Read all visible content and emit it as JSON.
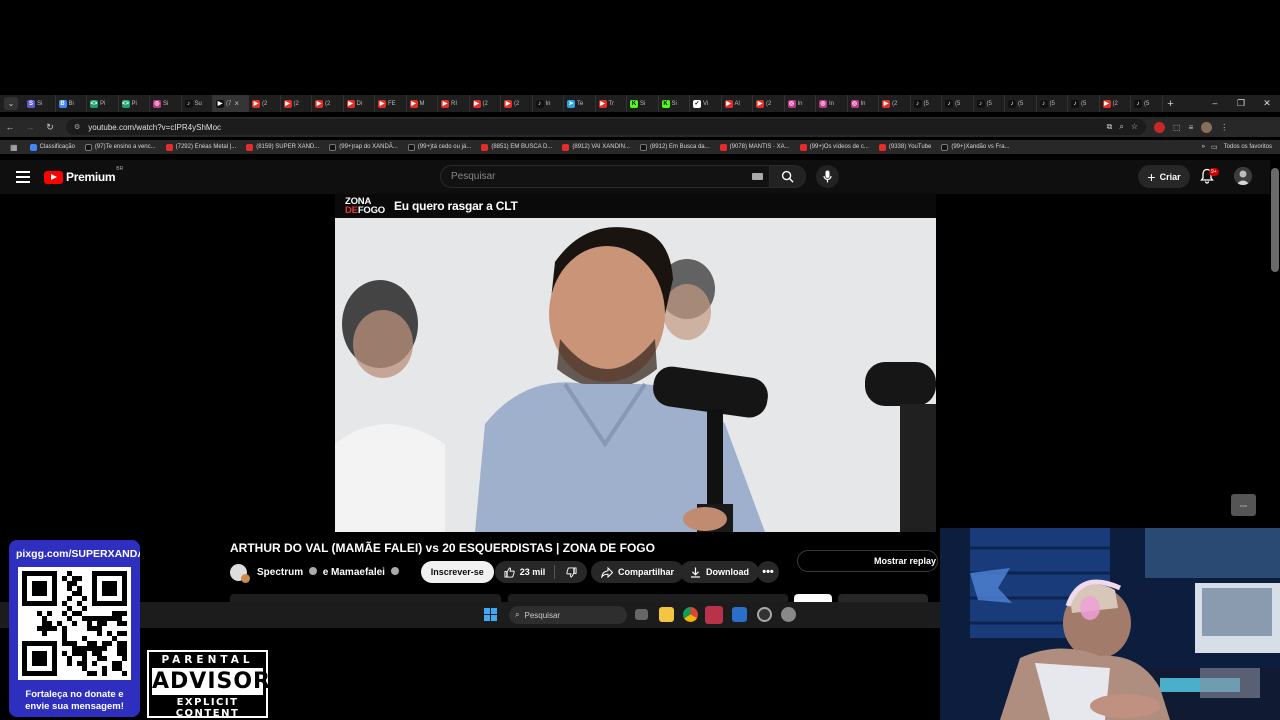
{
  "browser": {
    "tabs": [
      {
        "label": "Si",
        "color": "#5b5bd6",
        "glyph": "S"
      },
      {
        "label": "Bi",
        "color": "#4285f4",
        "glyph": "B"
      },
      {
        "label": "Pi",
        "color": "#22a06b",
        "glyph": "<>"
      },
      {
        "label": "Pi",
        "color": "#22a06b",
        "glyph": "<>"
      },
      {
        "label": "Si",
        "color": "#c13584",
        "glyph": "◎"
      },
      {
        "label": "Su",
        "color": "#111111",
        "glyph": "♪"
      },
      {
        "label": "(7",
        "color": "#111111",
        "glyph": "▶",
        "active": true
      },
      {
        "label": "(2",
        "color": "#e52d27",
        "glyph": "▶"
      },
      {
        "label": "(2",
        "color": "#e52d27",
        "glyph": "▶"
      },
      {
        "label": "(2",
        "color": "#e52d27",
        "glyph": "▶"
      },
      {
        "label": "Di",
        "color": "#e52d27",
        "glyph": "▶"
      },
      {
        "label": "FE",
        "color": "#e52d27",
        "glyph": "▶"
      },
      {
        "label": "M",
        "color": "#e52d27",
        "glyph": "▶"
      },
      {
        "label": "RI",
        "color": "#e52d27",
        "glyph": "▶"
      },
      {
        "label": "(2",
        "color": "#e52d27",
        "glyph": "▶"
      },
      {
        "label": "(2",
        "color": "#e52d27",
        "glyph": "▶"
      },
      {
        "label": "In",
        "color": "#111111",
        "glyph": "♪"
      },
      {
        "label": "Te",
        "color": "#2aa3e0",
        "glyph": "➤"
      },
      {
        "label": "Tr",
        "color": "#e52d27",
        "glyph": "▶"
      },
      {
        "label": "Si",
        "color": "#53fc18",
        "glyph": "K"
      },
      {
        "label": "Si",
        "color": "#53fc18",
        "glyph": "K"
      },
      {
        "label": "Vi",
        "color": "#ffffff",
        "glyph": "✓"
      },
      {
        "label": "Al",
        "color": "#e52d27",
        "glyph": "▶"
      },
      {
        "label": "(2",
        "color": "#e52d27",
        "glyph": "▶"
      },
      {
        "label": "In",
        "color": "#c13584",
        "glyph": "◎"
      },
      {
        "label": "In",
        "color": "#c13584",
        "glyph": "◎"
      },
      {
        "label": "In",
        "color": "#c13584",
        "glyph": "◎"
      },
      {
        "label": "(2",
        "color": "#e52d27",
        "glyph": "▶"
      },
      {
        "label": "(5",
        "color": "#111111",
        "glyph": "♪"
      },
      {
        "label": "(5",
        "color": "#111111",
        "glyph": "♪"
      },
      {
        "label": "(5",
        "color": "#111111",
        "glyph": "♪"
      },
      {
        "label": "(5",
        "color": "#111111",
        "glyph": "♪"
      },
      {
        "label": "(5",
        "color": "#111111",
        "glyph": "♪"
      },
      {
        "label": "(5",
        "color": "#111111",
        "glyph": "♪"
      },
      {
        "label": "(2",
        "color": "#e52d27",
        "glyph": "▶"
      },
      {
        "label": "(5",
        "color": "#111111",
        "glyph": "♪"
      }
    ],
    "url": "youtube.com/watch?v=cIPR4yShMoc",
    "bookmarks": [
      {
        "label": "Classificação",
        "color": "#4285f4"
      },
      {
        "label": "(97)Te ensino a venc...",
        "color": "#111111"
      },
      {
        "label": "(7292) Enéas Metal |...",
        "color": "#e52d27"
      },
      {
        "label": "(8159) SUPER XAND...",
        "color": "#e52d27"
      },
      {
        "label": "(99+)rap do XANDÃ...",
        "color": "#111111"
      },
      {
        "label": "(99+)tá cedo ou já...",
        "color": "#111111"
      },
      {
        "label": "(8851) EM BUSCA D...",
        "color": "#e52d27"
      },
      {
        "label": "(8912) VAI XANDIN...",
        "color": "#e52d27"
      },
      {
        "label": "(8912) Em Busca da...",
        "color": "#111111"
      },
      {
        "label": "(9078) MANTIS · XA...",
        "color": "#e52d27"
      },
      {
        "label": "(99+)Os vídeos de c...",
        "color": "#e52d27"
      },
      {
        "label": "(9338) YouTube",
        "color": "#e52d27"
      },
      {
        "label": "(99+)Xandão vs Fra...",
        "color": "#111111"
      }
    ],
    "all_bookmarks_label": "Todos os favoritos"
  },
  "youtube": {
    "brand": "Premium",
    "region": "BR",
    "search_placeholder": "Pesquisar",
    "create_label": "Criar",
    "notif_badge": "9+",
    "video_banner_top": "ZONA",
    "video_banner_bottom": "FOGO",
    "video_banner_bottom_accent": "DE",
    "video_banner_text": "Eu quero rasgar a CLT",
    "title": "ARTHUR DO VAL (MAMÃE FALEI) vs 20 ESQUERDISTAS | ZONA DE FOGO",
    "channel_name_1": "Spectrum",
    "channel_connector": "e",
    "channel_name_2": "Mamaefalei",
    "subscribe_label": "Inscrever-se",
    "like_count": "23 mil",
    "share_label": "Compartilhar",
    "download_label": "Download",
    "more_label": "•••",
    "replay_label": "Mostrar replay do chat"
  },
  "taskbar": {
    "search_placeholder": "Pesquisar"
  },
  "overlay": {
    "donate_url": "pixgg.com/SUPERXANDAO",
    "donate_message_line1": "Fortaleça no donate e",
    "donate_message_line2": "envie sua mensagem!",
    "advisory_top": "PARENTAL",
    "advisory_mid": "ADVISORY",
    "advisory_bottom": "EXPLICIT CONTENT"
  },
  "colors": {
    "yt_red": "#ff0000",
    "donate_bg": "#2f2fbf",
    "chrome_bg": "#1f1f1f"
  }
}
